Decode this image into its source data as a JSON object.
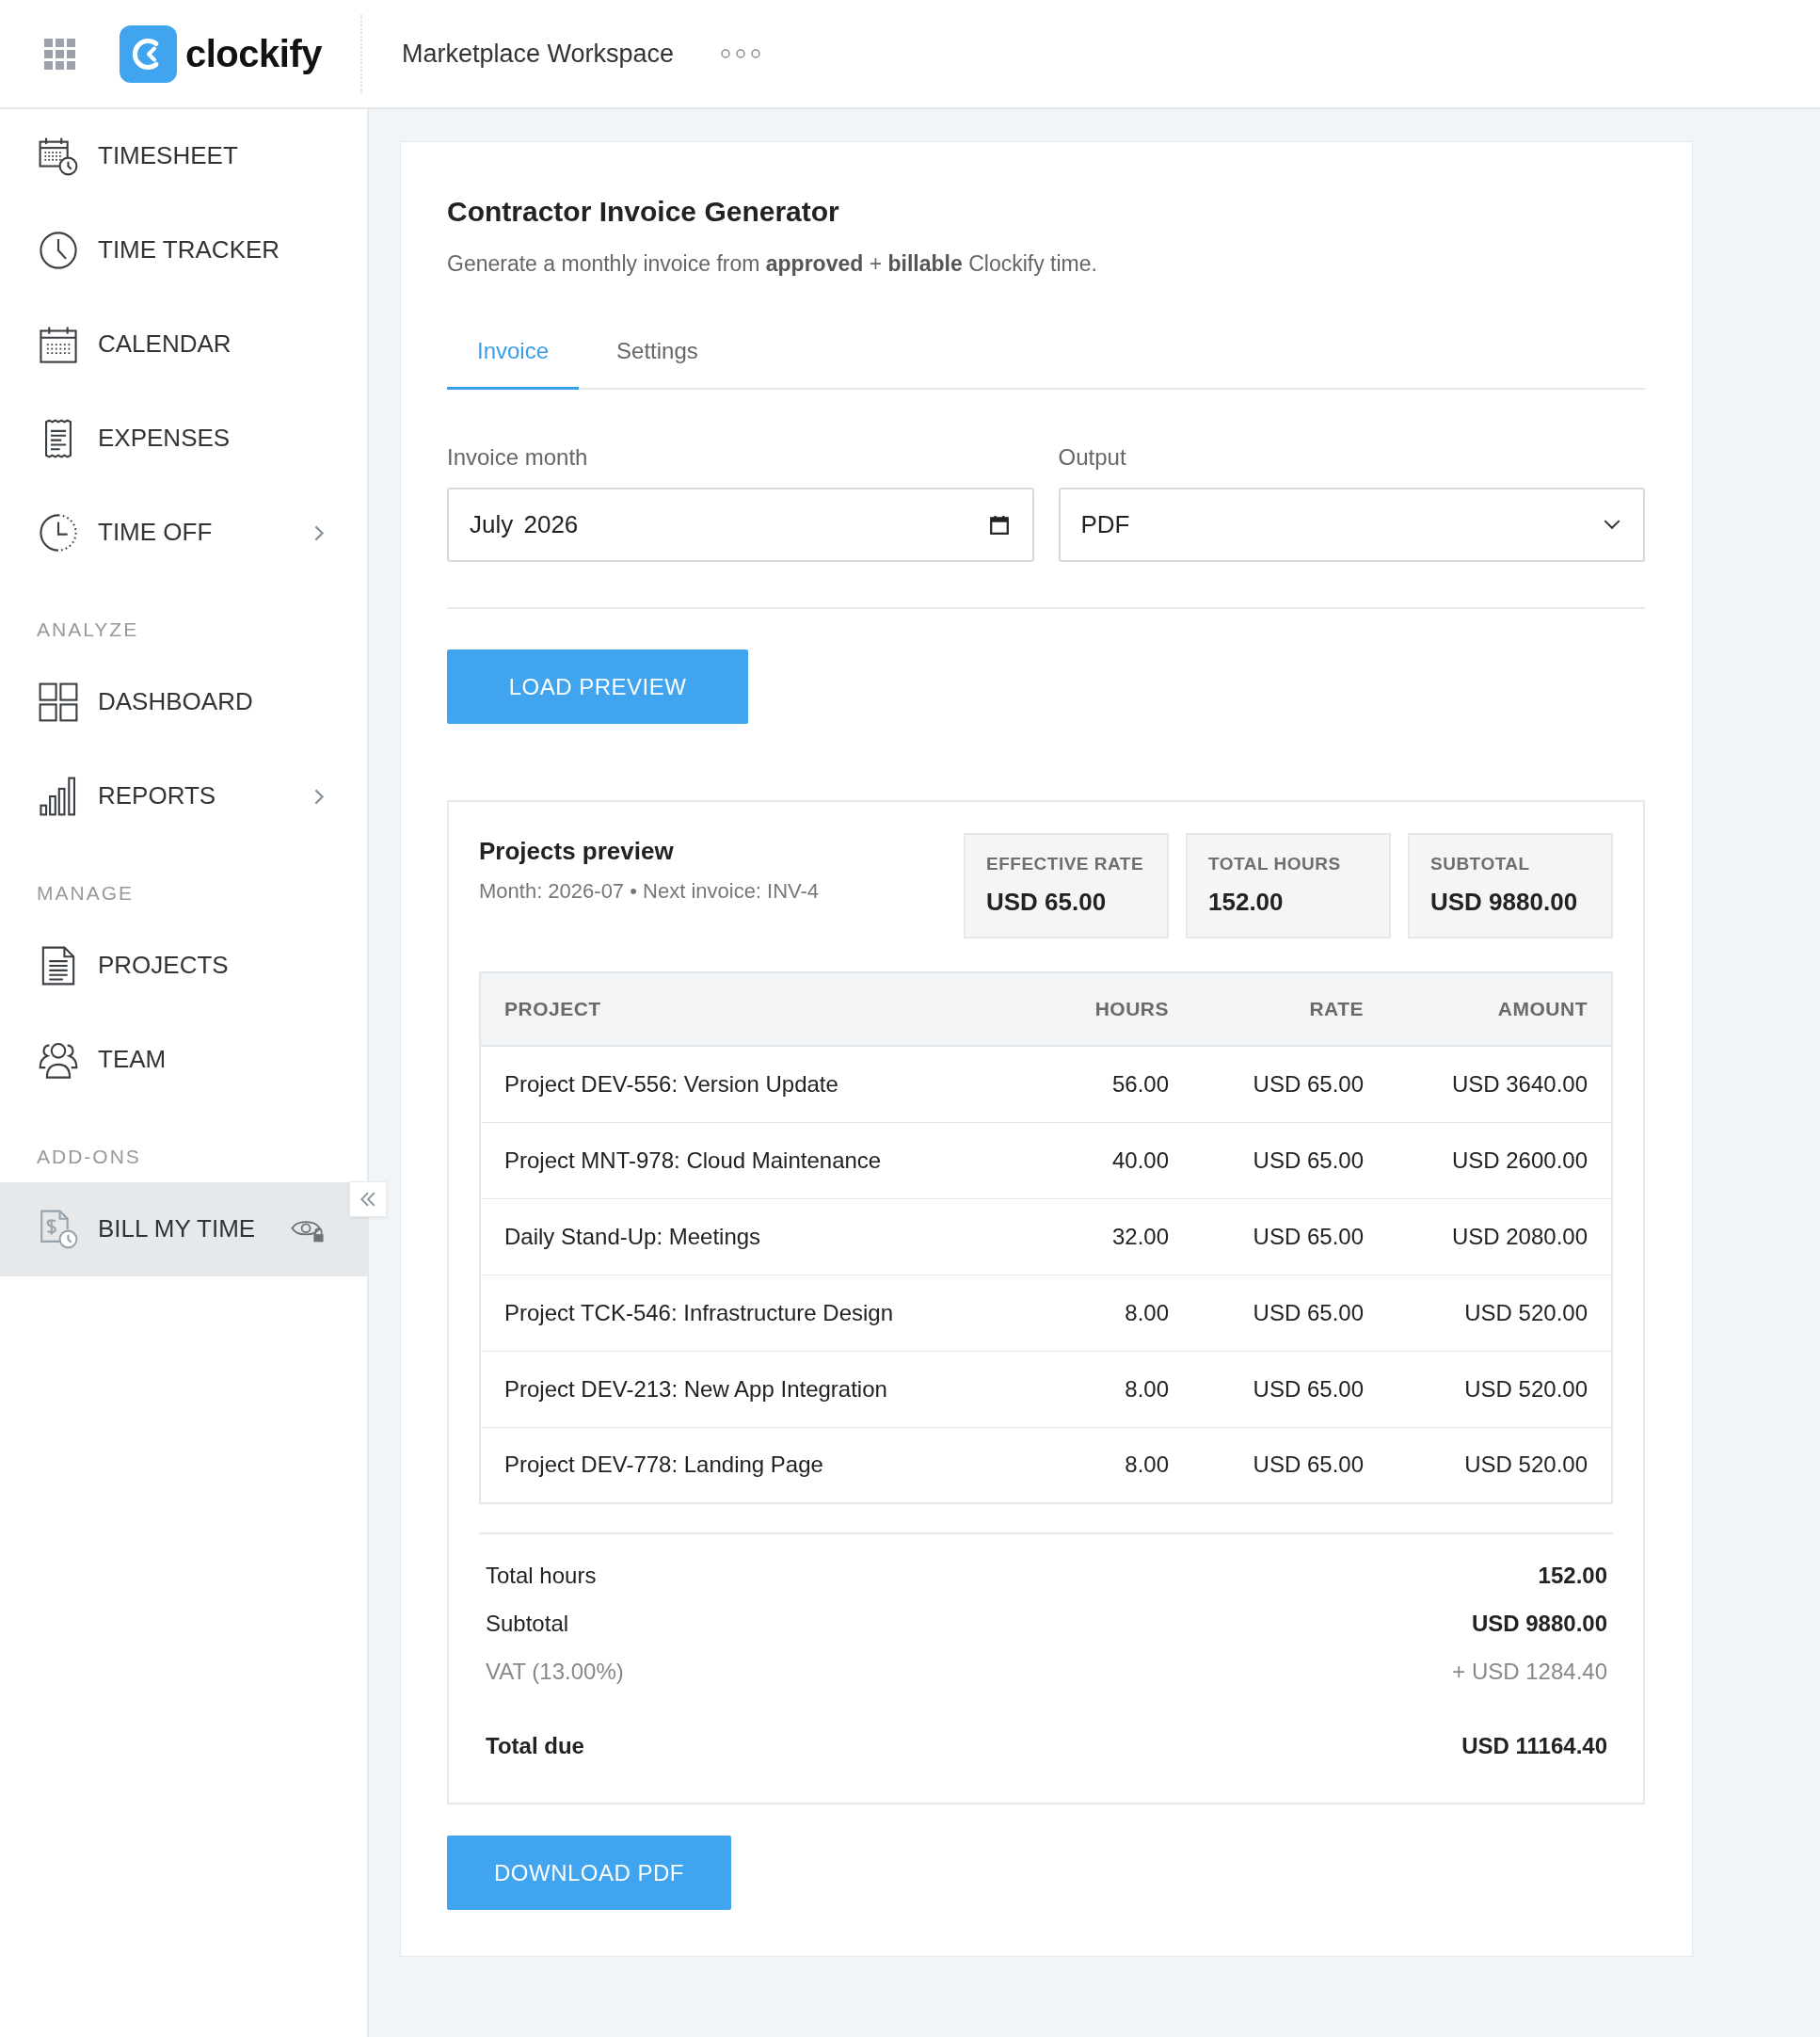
{
  "header": {
    "app_name": "clockify",
    "workspace": "Marketplace Workspace"
  },
  "sidebar": {
    "sections": [
      {
        "items": [
          {
            "label": "TIMESHEET",
            "selected": false,
            "submenu": false,
            "restricted": false
          },
          {
            "label": "TIME TRACKER",
            "selected": false,
            "submenu": false,
            "restricted": false
          },
          {
            "label": "CALENDAR",
            "selected": false,
            "submenu": false,
            "restricted": false
          },
          {
            "label": "EXPENSES",
            "selected": false,
            "submenu": false,
            "restricted": false
          },
          {
            "label": "TIME OFF",
            "selected": false,
            "submenu": true,
            "restricted": false
          }
        ]
      },
      {
        "title": "ANALYZE",
        "items": [
          {
            "label": "DASHBOARD",
            "selected": false,
            "submenu": false,
            "restricted": false
          },
          {
            "label": "REPORTS",
            "selected": false,
            "submenu": true,
            "restricted": false
          }
        ]
      },
      {
        "title": "MANAGE",
        "items": [
          {
            "label": "PROJECTS",
            "selected": false,
            "submenu": false,
            "restricted": false
          },
          {
            "label": "TEAM",
            "selected": false,
            "submenu": false,
            "restricted": false
          }
        ]
      },
      {
        "title": "ADD-ONS",
        "items": [
          {
            "label": "BILL MY TIME",
            "selected": true,
            "submenu": false,
            "restricted": true
          }
        ]
      }
    ]
  },
  "page": {
    "title": "Contractor Invoice Generator",
    "subtitle": "Generate a monthly invoice from **approved** + **billable** Clockify time.",
    "tabs": [
      {
        "label": "Invoice",
        "selected": true
      },
      {
        "label": "Settings",
        "selected": false
      }
    ],
    "fields": [
      {
        "kind": "month",
        "label": "Invoice month",
        "value": "July 2026"
      },
      {
        "kind": "select",
        "label": "Output",
        "value": "PDF"
      }
    ],
    "load_button": "LOAD PREVIEW",
    "preview": {
      "title": "Projects preview",
      "meta": "Month: 2026-07 • Next invoice: INV-4",
      "stats": [
        {
          "label": "EFFECTIVE RATE",
          "value": "USD 65.00"
        },
        {
          "label": "TOTAL HOURS",
          "value": "152.00"
        },
        {
          "label": "SUBTOTAL",
          "value": "USD 9880.00"
        }
      ],
      "table": {
        "columns": [
          "PROJECT",
          "HOURS",
          "RATE",
          "AMOUNT"
        ],
        "rows": [
          [
            "Project DEV-556: Version Update",
            "56.00",
            "USD 65.00",
            "USD 3640.00"
          ],
          [
            "Project MNT-978: Cloud Maintenance",
            "40.00",
            "USD 65.00",
            "USD 2600.00"
          ],
          [
            "Daily Stand-Up: Meetings",
            "32.00",
            "USD 65.00",
            "USD 2080.00"
          ],
          [
            "Project TCK-546: Infrastructure Design",
            "8.00",
            "USD 65.00",
            "USD 520.00"
          ],
          [
            "Project DEV-213: New App Integration",
            "8.00",
            "USD 65.00",
            "USD 520.00"
          ],
          [
            "Project DEV-778: Landing Page",
            "8.00",
            "USD 65.00",
            "USD 520.00"
          ]
        ]
      },
      "totals": [
        {
          "kind": "line",
          "label": "Total hours",
          "value": "152.00"
        },
        {
          "kind": "line",
          "label": "Subtotal",
          "value": "USD 9880.00"
        },
        {
          "kind": "muted",
          "label": "VAT (13.00%)",
          "value": "+ USD 1284.40"
        },
        {
          "kind": "total",
          "label": "Total due",
          "value": "USD 11164.40"
        }
      ]
    },
    "download_button": "DOWNLOAD PDF"
  }
}
